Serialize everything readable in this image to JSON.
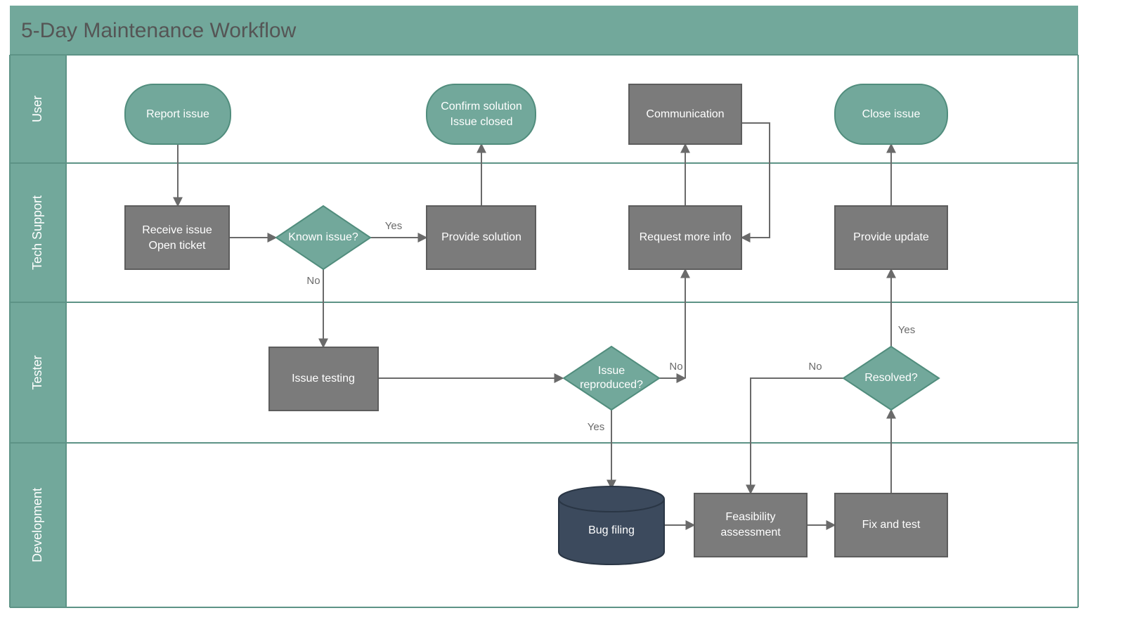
{
  "title": "5-Day Maintenance Workflow",
  "lanes": {
    "user": "User",
    "tech": "Tech Support",
    "tester": "Tester",
    "dev": "Development"
  },
  "nodes": {
    "report": "Report issue",
    "confirm1": "Confirm solution",
    "confirm2": "Issue closed",
    "comm": "Communication",
    "close": "Close issue",
    "receive1": "Receive issue",
    "receive2": "Open ticket",
    "known": "Known issue?",
    "provide_sol": "Provide solution",
    "req_info": "Request more info",
    "provide_upd": "Provide update",
    "test": "Issue testing",
    "reproduced1": "Issue",
    "reproduced2": "reproduced?",
    "resolved": "Resolved?",
    "bug": "Bug filing",
    "feas1": "Feasibility",
    "feas2": "assessment",
    "fix": "Fix and test"
  },
  "edges": {
    "yes": "Yes",
    "no": "No"
  },
  "colors": {
    "teal": "#72a89b",
    "teal_dark": "#518d7d",
    "header": "#72a89b",
    "gray": "#7b7b7b",
    "navy": "#3c4a5d",
    "line": "#6a6a6a",
    "lane_border": "#5d9386"
  }
}
